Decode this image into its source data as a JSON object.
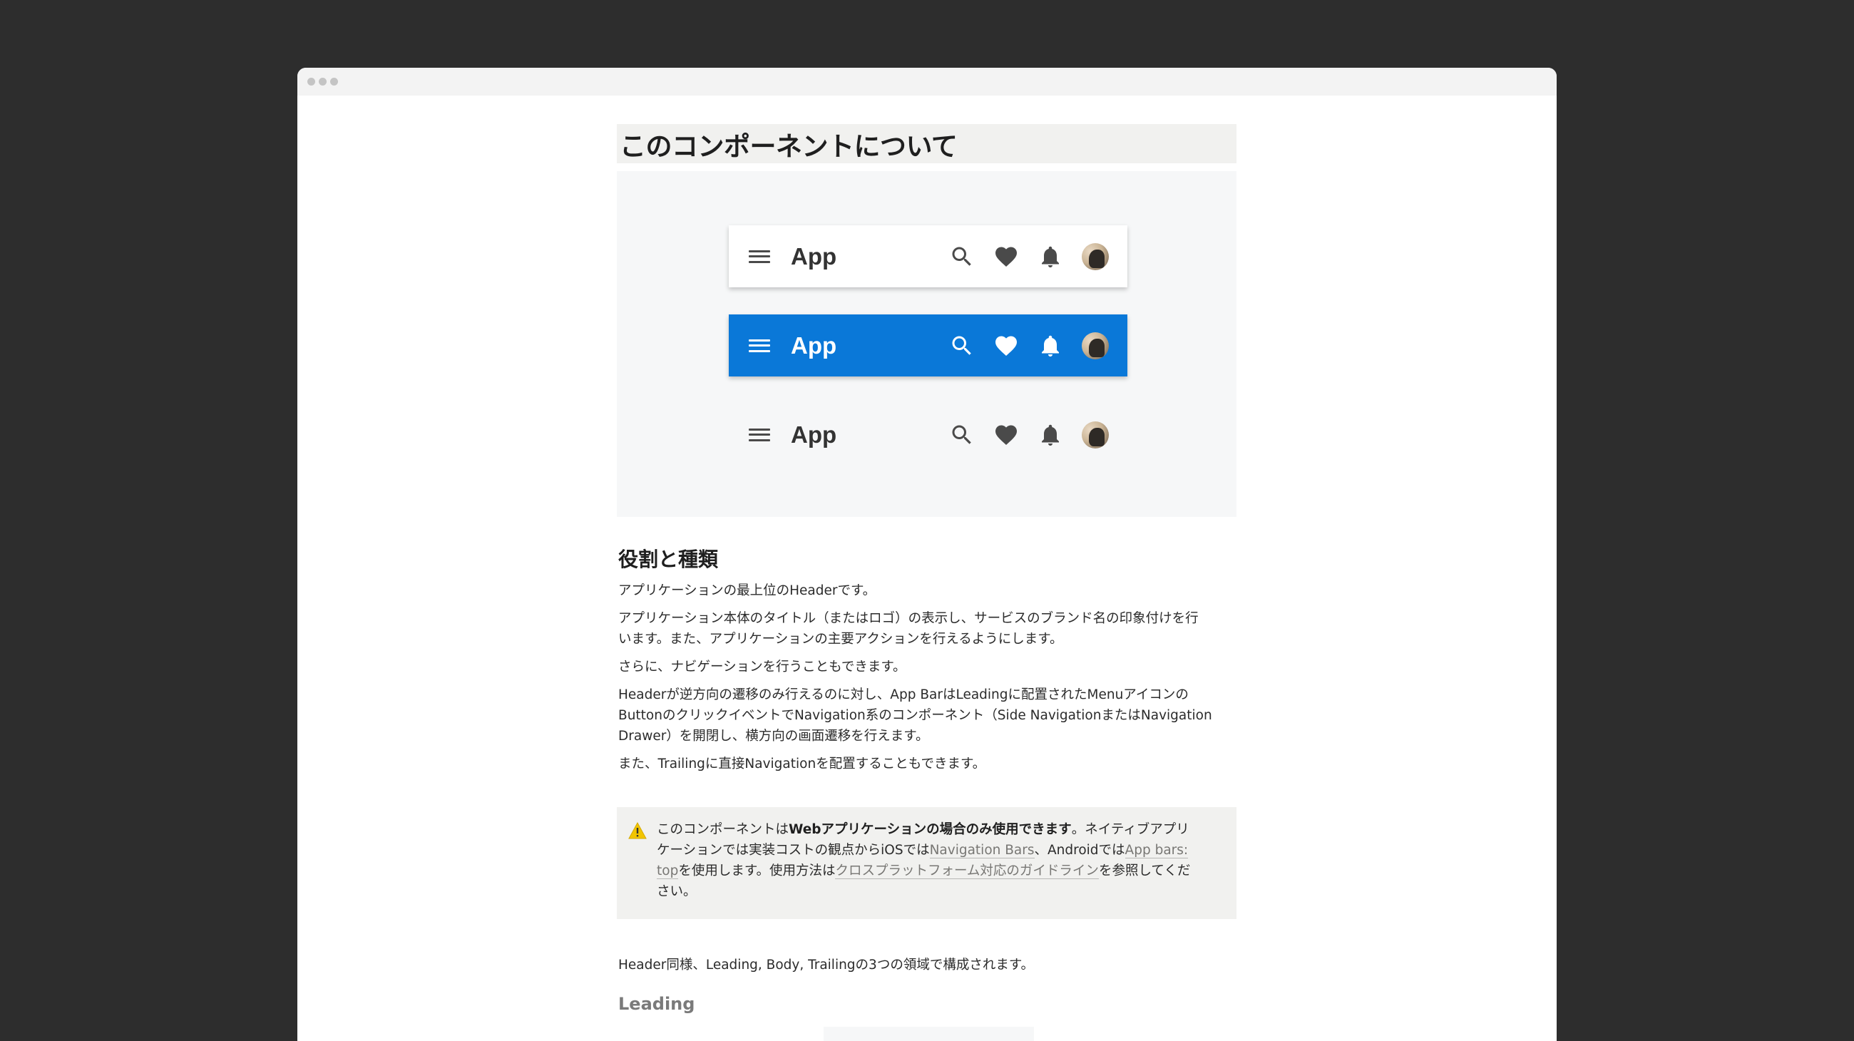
{
  "page": {
    "title": "このコンポーネントについて"
  },
  "preview": {
    "appbars": [
      {
        "variant": "white",
        "title": "App"
      },
      {
        "variant": "blue",
        "title": "App"
      },
      {
        "variant": "flat",
        "title": "App"
      }
    ],
    "icons": [
      "menu-icon",
      "search-icon",
      "heart-icon",
      "bell-icon",
      "avatar"
    ],
    "colors": {
      "primary": "#0a78d8",
      "icon_dark": "#4a4a4a",
      "icon_light": "#ffffff"
    }
  },
  "section1": {
    "heading": "役割と種類",
    "p1": "アプリケーションの最上位のHeaderです。",
    "p2a": "アプリケーション本体のタイトル（またはロゴ）の表示し、サービスのブランド名の印象付けを行",
    "p2b": "います。また、アプリケーションの主要アクションを行えるようにします。",
    "p3": "さらに、ナビゲーションを行うこともできます。",
    "p4a": "Headerが逆方向の遷移のみ行えるのに対し、App BarはLeadingに配置されたMenuアイコンの",
    "p4b": "ButtonのクリックイベントでNavigation系のコンポーネント（Side NavigationまたはNavigation",
    "p4c": "Drawer）を開閉し、横方向の画面遷移を行えます。",
    "p5": "また、Trailingに直接Navigationを配置することもできます。"
  },
  "callout": {
    "l1_pre": "このコンポーネントは",
    "l1_bold": "Webアプリケーションの場合のみ使用できます",
    "l1_post": "。ネイティブアプリ",
    "l2_pre": "ケーションでは実装コストの観点からiOSでは",
    "l2_link1": "Navigation Bars",
    "l2_mid": "、Androidでは",
    "l2_link2": "App bars:",
    "l3_link2b": "top",
    "l3_mid": "を使用します。使用方法は",
    "l3_link3": "クロスプラットフォーム対応のガイドライン",
    "l3_post": "を参照してくだ",
    "l4": "さい。"
  },
  "section2": {
    "p1": "Header同様、Leading, Body, Trailingの3つの領域で構成されます。",
    "h3": "Leading"
  }
}
